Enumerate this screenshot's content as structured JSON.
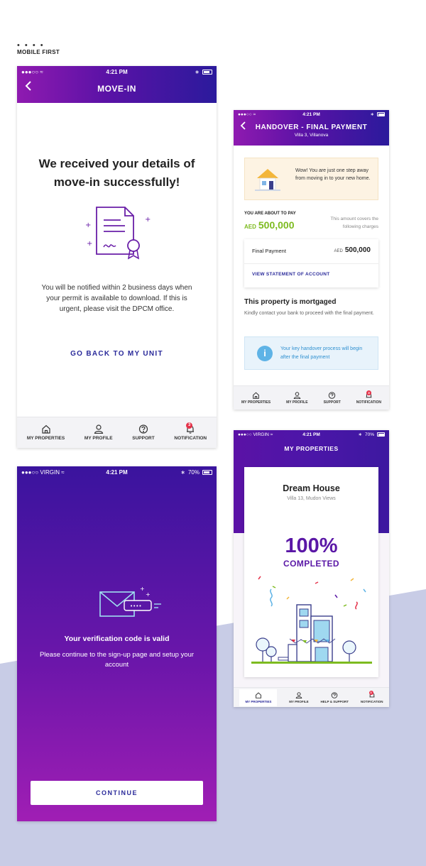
{
  "page": {
    "dots": "• • • •",
    "label": "MOBILE FIRST"
  },
  "status": {
    "carrier_dots": "●●●○○",
    "carrier": "VIRGIN",
    "time": "4:21 PM",
    "battery": "70%"
  },
  "moveIn": {
    "title": "MOVE-IN",
    "back_icon": "chevron-left-icon",
    "heading": "We received your details of move-in successfully!",
    "body": "You will be notified within 2 business days when your permit is available to download. If this is urgent, please visit the DPCM office.",
    "link": "GO BACK TO MY UNIT",
    "tabs": [
      {
        "label": "MY PROPERTIES",
        "icon": "home-icon"
      },
      {
        "label": "MY PROFILE",
        "icon": "user-icon"
      },
      {
        "label": "SUPPORT",
        "icon": "help-icon"
      },
      {
        "label": "NOTIFICATION",
        "icon": "bell-icon",
        "badge": "3"
      }
    ]
  },
  "handover": {
    "title": "HANDOVER - FINAL PAYMENT",
    "subtitle": "Villa 3, Villanova",
    "note": "Wow! You are just one step away  from moving in to your new home.",
    "pay_label": "YOU ARE ABOUT TO PAY",
    "currency": "AED",
    "amount": "500,000",
    "covers": "This amount covers the following charges",
    "charge_label": "Final Payment",
    "charge_amount": "500,000",
    "statement_link": "VIEW STATEMENT OF ACCOUNT",
    "mortgage_title": "This property is mortgaged",
    "mortgage_text": "Kindly contact your bank to proceed with the final payment.",
    "info_icon": "i",
    "info_text": "Your key handover process will begin after the final payment",
    "tabs": [
      {
        "label": "MY PROPERTIES"
      },
      {
        "label": "MY PROFILE"
      },
      {
        "label": "SUPPORT"
      },
      {
        "label": "NOTIFICATION",
        "badge": "3"
      }
    ]
  },
  "verification": {
    "title": "Your verification code is valid",
    "text": "Please continue to the sign-up page and setup your account",
    "code_dots": "••••",
    "button": "CONTINUE"
  },
  "properties": {
    "title": "MY PROPERTIES",
    "name": "Dream House",
    "location": "Villa 13, Mudon Views",
    "percent": "100%",
    "completed": "COMPLETED",
    "tabs": [
      {
        "label": "MY PROPERTIES",
        "active": true
      },
      {
        "label": "MY PROFILE"
      },
      {
        "label": "HELP & SUPPORT"
      },
      {
        "label": "NOTIFICATION",
        "badge": "3"
      }
    ]
  },
  "colors": {
    "accent": "#2a2a9a",
    "brand_purple": "#5a17a6",
    "green": "#7dbb1f",
    "badge": "#e5334b",
    "bg_shape": "#c8cce6"
  }
}
